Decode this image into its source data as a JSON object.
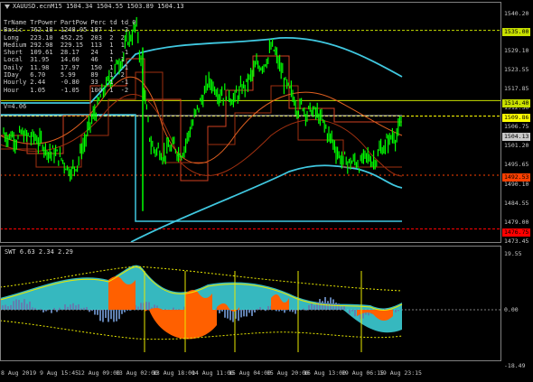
{
  "main_title": "XAUUSD.ecnM15  1504.34 1504.55 1503.89 1504.13",
  "table": {
    "headers": [
      "TrName",
      "TrPower",
      "PartPow",
      "Perc",
      "td",
      "td_0"
    ],
    "rows": [
      [
        "Basic",
        "762.18",
        "1248.05",
        "187",
        "1",
        "-2"
      ],
      [
        "Long",
        "223.10",
        "452.25",
        "203",
        "2",
        "2"
      ],
      [
        "Medium",
        "292.98",
        "229.15",
        "113",
        "1",
        "1"
      ],
      [
        "Short",
        "109.61",
        "28.17",
        "24",
        "1",
        "-1"
      ],
      [
        "Local",
        "31.95",
        "14.60",
        "46",
        "1",
        "1"
      ],
      [
        "Daily",
        "11.98",
        "17.97",
        "150",
        "1",
        "-1"
      ],
      [
        "IDay",
        "6.70",
        "5.99",
        "89",
        "1",
        "2"
      ],
      [
        "Hourly",
        "2.44",
        "-0.80",
        "33",
        "1",
        "-1"
      ],
      [
        "Hour",
        "1.05",
        "-1.05",
        "100",
        "1",
        "-2"
      ]
    ]
  },
  "v_label": "V=4.06",
  "y_labels": [
    "1540.20",
    "1535.00",
    "1529.10",
    "1523.55",
    "1517.85",
    "1512.30",
    "1506.75",
    "1501.20",
    "1495.65",
    "1490.10",
    "1484.55",
    "1479.00",
    "1473.45"
  ],
  "price_tags": [
    {
      "text": "1535.00",
      "bg": "#c8e000",
      "fg": "#000"
    },
    {
      "text": "1514.40",
      "bg": "#c8e000",
      "fg": "#000"
    },
    {
      "text": "1509.86",
      "bg": "#ffff00",
      "fg": "#000"
    },
    {
      "text": "1504.13",
      "bg": "#c8c8c8",
      "fg": "#000"
    },
    {
      "text": "1492.53",
      "bg": "#ff4000",
      "fg": "#000"
    },
    {
      "text": "1476.75",
      "bg": "#ff0000",
      "fg": "#000"
    }
  ],
  "sub_title": "SWT  6.63 2.34 2.29",
  "sub_y_labels": [
    "19.55",
    "0.00",
    "-18.49"
  ],
  "x_labels": [
    "8 Aug 2019",
    "9 Aug 15:45",
    "12 Aug 09:00",
    "13 Aug 02:00",
    "13 Aug 18:00",
    "14 Aug 11:00",
    "15 Aug 04:00",
    "15 Aug 20:00",
    "16 Aug 13:00",
    "19 Aug 06:15",
    "19 Aug 23:15"
  ],
  "colors": {
    "candles": "#00ff00",
    "channel": "#40c8e0",
    "ma_orange": "#e06020",
    "ma_dark": "#a03010",
    "step": "#d04020",
    "level_yellow": "#c8e000",
    "level_red": "#ff0000",
    "swt_cyan": "#40d8e0",
    "swt_orange": "#ff6000",
    "swt_yellow": "#e8e800",
    "swt_steel": "#6080b0"
  }
}
